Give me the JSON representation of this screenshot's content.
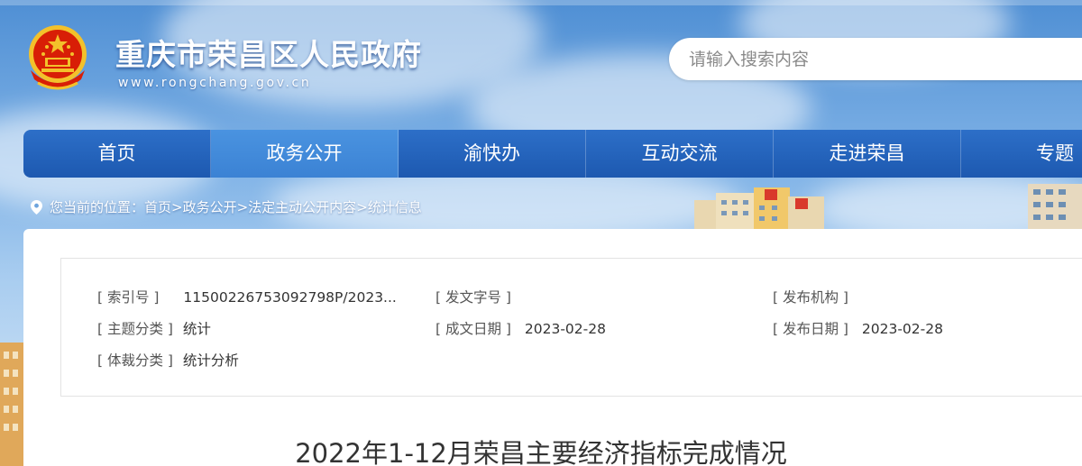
{
  "header": {
    "site_title": "重庆市荣昌区人民政府",
    "site_url": "www.rongchang.gov.cn"
  },
  "search": {
    "placeholder": "请输入搜索内容"
  },
  "nav": {
    "items": [
      {
        "label": "首页"
      },
      {
        "label": "政务公开",
        "active": true
      },
      {
        "label": "渝快办"
      },
      {
        "label": "互动交流"
      },
      {
        "label": "走进荣昌"
      },
      {
        "label": "专题"
      }
    ]
  },
  "breadcrumb": {
    "prefix": "您当前的位置：",
    "items": [
      "首页",
      ">政务公开",
      ">法定主动公开内容",
      ">统计信息"
    ]
  },
  "meta": {
    "index_no_label": "[ 索引号 ]",
    "index_no_value": "11500226753092798P/2023...",
    "doc_no_label": "[ 发文字号 ]",
    "doc_no_value": "",
    "publisher_label": "[ 发布机构 ]",
    "publisher_value": "",
    "topic_label": "[ 主题分类 ]",
    "topic_value": "统计",
    "created_label": "[ 成文日期 ]",
    "created_value": "2023-02-28",
    "published_label": "[ 发布日期 ]",
    "published_value": "2023-02-28",
    "genre_label": "[ 体裁分类 ]",
    "genre_value": "统计分析"
  },
  "article": {
    "title": "2022年1-12月荣昌主要经济指标完成情况"
  },
  "colors": {
    "nav_bg": "#1d59b0",
    "nav_active": "#3b82d4",
    "emblem_red": "#d81e06",
    "emblem_gold": "#f3c12b"
  }
}
